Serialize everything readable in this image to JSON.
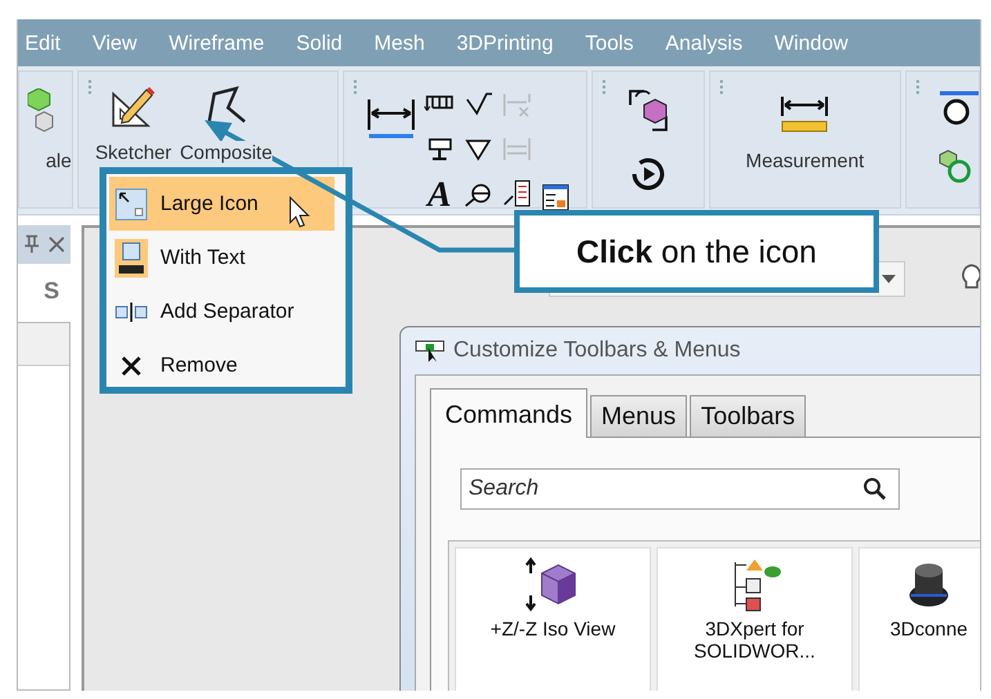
{
  "menu_bar": [
    {
      "label": "Edit"
    },
    {
      "label": "View"
    },
    {
      "label": "Wireframe"
    },
    {
      "label": "Solid"
    },
    {
      "label": "Mesh"
    },
    {
      "label": "3DPrinting"
    },
    {
      "label": "Tools"
    },
    {
      "label": "Analysis"
    },
    {
      "label": "Window"
    }
  ],
  "toolbar": {
    "cut_label": "ale",
    "sketch_buttons": [
      {
        "kind": "sketcher",
        "label": "Sketcher"
      },
      {
        "kind": "composite",
        "label": "Composite"
      }
    ],
    "text_glyph": "A",
    "measurement_label": "Measurement"
  },
  "side_panel": {
    "tab_label": "S"
  },
  "context_menu": [
    {
      "kind": "large_icon",
      "label": "Large Icon",
      "selected": true
    },
    {
      "kind": "with_text",
      "label": "With Text",
      "selected": false
    },
    {
      "kind": "separator",
      "label": "Add Separator",
      "selected": false
    },
    {
      "kind": "remove",
      "label": "Remove",
      "selected": false
    }
  ],
  "dialog": {
    "title": "Customize Toolbars & Menus",
    "tabs": [
      {
        "label": "Commands",
        "selected": true
      },
      {
        "label": "Menus",
        "selected": false
      },
      {
        "label": "Toolbars",
        "selected": false
      }
    ],
    "search": {
      "placeholder": "Search"
    },
    "commands": [
      {
        "kind": "iso_view",
        "label": "+Z/-Z Iso View"
      },
      {
        "kind": "tree",
        "label": "3DXpert for SOLIDWOR..."
      },
      {
        "kind": "knob",
        "label": "3Dconne"
      }
    ]
  },
  "callout": {
    "text": "**Click** on the icon"
  }
}
